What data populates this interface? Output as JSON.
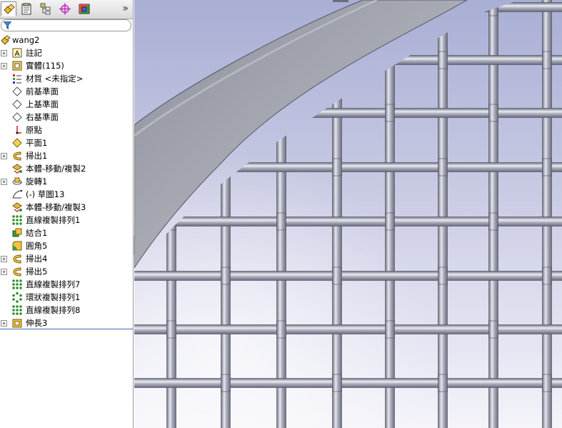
{
  "panel_tabs": [
    {
      "icon": "featuremanager-tree-icon",
      "active": true
    },
    {
      "icon": "propertymanager-icon"
    },
    {
      "icon": "configurationmanager-icon"
    },
    {
      "icon": "dimxpert-manager-icon"
    },
    {
      "icon": "display-manager-icon"
    }
  ],
  "collapse_symbol": "»",
  "filter_icon": "filter-icon",
  "tree": {
    "root": "wang2",
    "root_icon": "part-icon",
    "items": [
      {
        "label": "註記",
        "icon": "annotations-icon",
        "expandable": true
      },
      {
        "label": "實體(115)",
        "icon": "solid-bodies-icon",
        "expandable": true
      },
      {
        "label": "材質 <未指定>",
        "icon": "material-icon",
        "expandable": false
      },
      {
        "label": "前基準面",
        "icon": "plane-icon",
        "expandable": false
      },
      {
        "label": "上基準面",
        "icon": "plane-icon",
        "expandable": false
      },
      {
        "label": "右基準面",
        "icon": "plane-icon",
        "expandable": false
      },
      {
        "label": "原點",
        "icon": "origin-icon",
        "expandable": false
      },
      {
        "label": "平面1",
        "icon": "ref-plane-icon",
        "expandable": false
      },
      {
        "label": "掃出1",
        "icon": "sweep-icon",
        "expandable": true
      },
      {
        "label": "本體-移動/複製2",
        "icon": "move-copy-body-icon",
        "expandable": false
      },
      {
        "label": "旋轉1",
        "icon": "revolve-icon",
        "expandable": true
      },
      {
        "label": "(-) 草圖13",
        "icon": "sketch-icon",
        "expandable": false
      },
      {
        "label": "本體-移動/複製3",
        "icon": "move-copy-body-icon",
        "expandable": false
      },
      {
        "label": "直線複製排列1",
        "icon": "linear-pattern-icon",
        "expandable": false
      },
      {
        "label": "結合1",
        "icon": "combine-icon",
        "expandable": false
      },
      {
        "label": "圓角5",
        "icon": "fillet-icon",
        "expandable": false
      },
      {
        "label": "掃出4",
        "icon": "sweep-icon",
        "expandable": true
      },
      {
        "label": "掃出5",
        "icon": "sweep-icon",
        "expandable": true
      },
      {
        "label": "直線複製排列7",
        "icon": "linear-pattern-icon",
        "expandable": false
      },
      {
        "label": "環狀複製排列1",
        "icon": "circular-pattern-icon",
        "expandable": false
      },
      {
        "label": "直線複製排列8",
        "icon": "linear-pattern-icon",
        "expandable": false
      },
      {
        "label": "伸長3",
        "icon": "extrude-icon",
        "expandable": true
      }
    ]
  },
  "viewport": {
    "content": "wire-mesh-with-curved-frame",
    "background_top": "#a9aed4",
    "background_bottom": "#f4f4fa",
    "wire_color": "#a7a9b6",
    "frame_color": "#9c9ea8"
  }
}
